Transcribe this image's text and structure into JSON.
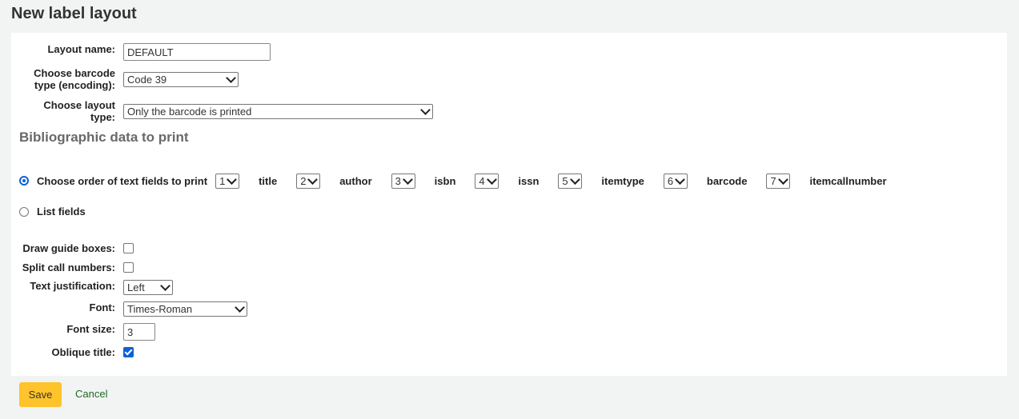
{
  "page_title": "New label layout",
  "form": {
    "layout_name": {
      "label": "Layout name:",
      "value": "DEFAULT"
    },
    "barcode_type": {
      "label_line1": "Choose barcode",
      "label_line2": "type (encoding):",
      "value": "Code 39"
    },
    "layout_type": {
      "label_line1": "Choose layout",
      "label_line2": "type:",
      "value": "Only the barcode is printed"
    },
    "bib_heading": "Bibliographic data to print",
    "order_option": {
      "label": "Choose order of text fields to print",
      "selected": true,
      "fields": [
        {
          "order": "1",
          "name": "title"
        },
        {
          "order": "2",
          "name": "author"
        },
        {
          "order": "3",
          "name": "isbn"
        },
        {
          "order": "4",
          "name": "issn"
        },
        {
          "order": "5",
          "name": "itemtype"
        },
        {
          "order": "6",
          "name": "barcode"
        },
        {
          "order": "7",
          "name": "itemcallnumber"
        }
      ]
    },
    "list_option": {
      "label": "List fields",
      "selected": false
    },
    "guide_boxes": {
      "label": "Draw guide boxes:",
      "checked": false
    },
    "split_call": {
      "label": "Split call numbers:",
      "checked": false
    },
    "justification": {
      "label": "Text justification:",
      "value": "Left"
    },
    "font": {
      "label": "Font:",
      "value": "Times-Roman"
    },
    "font_size": {
      "label": "Font size:",
      "value": "3"
    },
    "oblique": {
      "label": "Oblique title:",
      "checked": true
    }
  },
  "actions": {
    "save": "Save",
    "cancel": "Cancel"
  }
}
